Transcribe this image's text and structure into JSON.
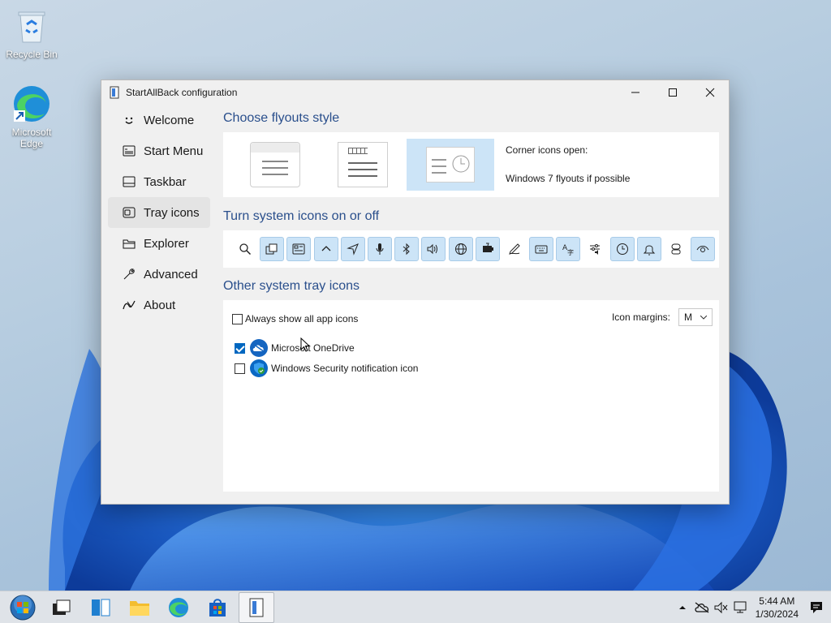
{
  "desktop": {
    "icons": [
      {
        "label": "Recycle Bin"
      },
      {
        "label": "Microsoft Edge"
      }
    ]
  },
  "window": {
    "title": "StartAllBack configuration",
    "sidebar": [
      {
        "label": "Welcome",
        "icon": "smile-icon"
      },
      {
        "label": "Start Menu",
        "icon": "start-menu-icon"
      },
      {
        "label": "Taskbar",
        "icon": "taskbar-icon"
      },
      {
        "label": "Tray icons",
        "icon": "tray-icon",
        "active": true
      },
      {
        "label": "Explorer",
        "icon": "folder-icon"
      },
      {
        "label": "Advanced",
        "icon": "wrench-icon"
      },
      {
        "label": "About",
        "icon": "about-icon"
      }
    ],
    "flyouts": {
      "section_title": "Choose flyouts style",
      "corner_label": "Corner icons open:",
      "mode_label": "Windows 7 flyouts if possible",
      "selected_index": 2
    },
    "system_icons": {
      "section_title": "Turn system icons on or off",
      "items": [
        {
          "icon": "search-icon",
          "on": false
        },
        {
          "icon": "task-view-icon",
          "on": true
        },
        {
          "icon": "widgets-icon",
          "on": true
        },
        {
          "icon": "chevron-up-icon",
          "on": true
        },
        {
          "icon": "location-icon",
          "on": true
        },
        {
          "icon": "microphone-icon",
          "on": true
        },
        {
          "icon": "bluetooth-icon",
          "on": true
        },
        {
          "icon": "volume-icon",
          "on": true
        },
        {
          "icon": "network-icon",
          "on": true
        },
        {
          "icon": "power-icon",
          "on": true
        },
        {
          "icon": "pen-icon",
          "on": false
        },
        {
          "icon": "keyboard-icon",
          "on": true
        },
        {
          "icon": "language-icon",
          "on": true
        },
        {
          "icon": "sound-settings-icon",
          "on": false
        },
        {
          "icon": "clock-icon",
          "on": true
        },
        {
          "icon": "notifications-icon",
          "on": true
        },
        {
          "icon": "meet-now-icon",
          "on": false
        },
        {
          "icon": "eye-icon",
          "on": true
        }
      ]
    },
    "tray": {
      "section_title": "Other system tray icons",
      "always_show_label": "Always show all app icons",
      "always_show_checked": false,
      "margins_label": "Icon margins:",
      "margins_value": "M",
      "apps": [
        {
          "label": "Microsoft OneDrive",
          "checked": true,
          "icon": "onedrive-icon"
        },
        {
          "label": "Windows Security notification icon",
          "checked": false,
          "icon": "security-icon"
        }
      ]
    }
  },
  "taskbar": {
    "time": "5:44 AM",
    "date": "1/30/2024",
    "apps": [
      "start-orb-icon",
      "task-view-icon",
      "widgets-icon",
      "file-explorer-icon",
      "edge-icon",
      "store-icon",
      "startallback-icon"
    ]
  }
}
